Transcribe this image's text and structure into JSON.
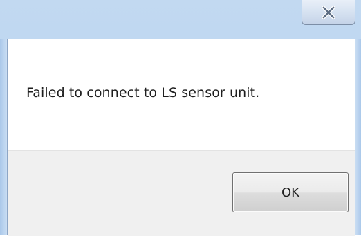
{
  "dialog": {
    "message": "Failed to connect to LS sensor unit.",
    "ok_label": "OK",
    "close_icon": "close-icon"
  },
  "colors": {
    "frame": "#bcd6f1",
    "client_background": "#f0f0f0",
    "message_background": "#ffffff",
    "text": "#1e1e1e"
  }
}
